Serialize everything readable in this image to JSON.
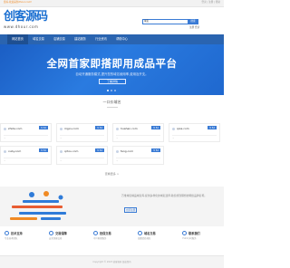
{
  "topbar": {
    "left": "您好,欢迎来到dhour.com!",
    "right": "登录 | 注册 | 帮助"
  },
  "logo": {
    "name": "创客源码",
    "sub": "www.dhour.com"
  },
  "search": {
    "category": "域名",
    "placeholder": "",
    "button": "搜索"
  },
  "header_links": "注册  登录",
  "nav": {
    "items": [
      "网站首页",
      "域名交易",
      "店铺交易",
      "建站服务",
      "行业资讯",
      "帮助中心"
    ]
  },
  "hero": {
    "title": "全网首家即搭即用成品平台",
    "subtitle": "自动开通服务模式,提升您的域名使用率,费用及开支。",
    "button": "了解详情"
  },
  "section": {
    "title": "一口价域名"
  },
  "domains": [
    {
      "name": "zhida.com",
      "price": "¥ 52",
      "meta": "..."
    },
    {
      "name": "mgxu.com",
      "price": "¥ 52",
      "meta": "..."
    },
    {
      "name": "huahan.com",
      "price": "¥ 52",
      "meta": "..."
    },
    {
      "name": "qixa.com",
      "price": "¥ 52",
      "meta": "..."
    },
    {
      "name": "xuby.com",
      "price": "¥ 52",
      "meta": "..."
    },
    {
      "name": "qrtou.com",
      "price": "¥ 52",
      "meta": "..."
    },
    {
      "name": "fang.com",
      "price": "¥ 52",
      "meta": "..."
    },
    {
      "name": "",
      "price": "",
      "meta": ""
    }
  ],
  "more": "查看更多 >",
  "promo": {
    "description": "万维域名精品域名库,提供多样化的域名选择,助您找到理想的网络品牌名称。",
    "button": "立即注册"
  },
  "features": [
    {
      "title": "技术支持",
      "text": "专业技术团队"
    },
    {
      "title": "交易保障",
      "text": "安全快捷交易"
    },
    {
      "title": "担保交易",
      "text": "中介担保服务"
    },
    {
      "title": "域名交易",
      "text": "海量优质域名"
    },
    {
      "title": "联系我们",
      "text": "7x24小时服务"
    }
  ],
  "footer": "Copyright © 2023 创客源码 版权所有"
}
